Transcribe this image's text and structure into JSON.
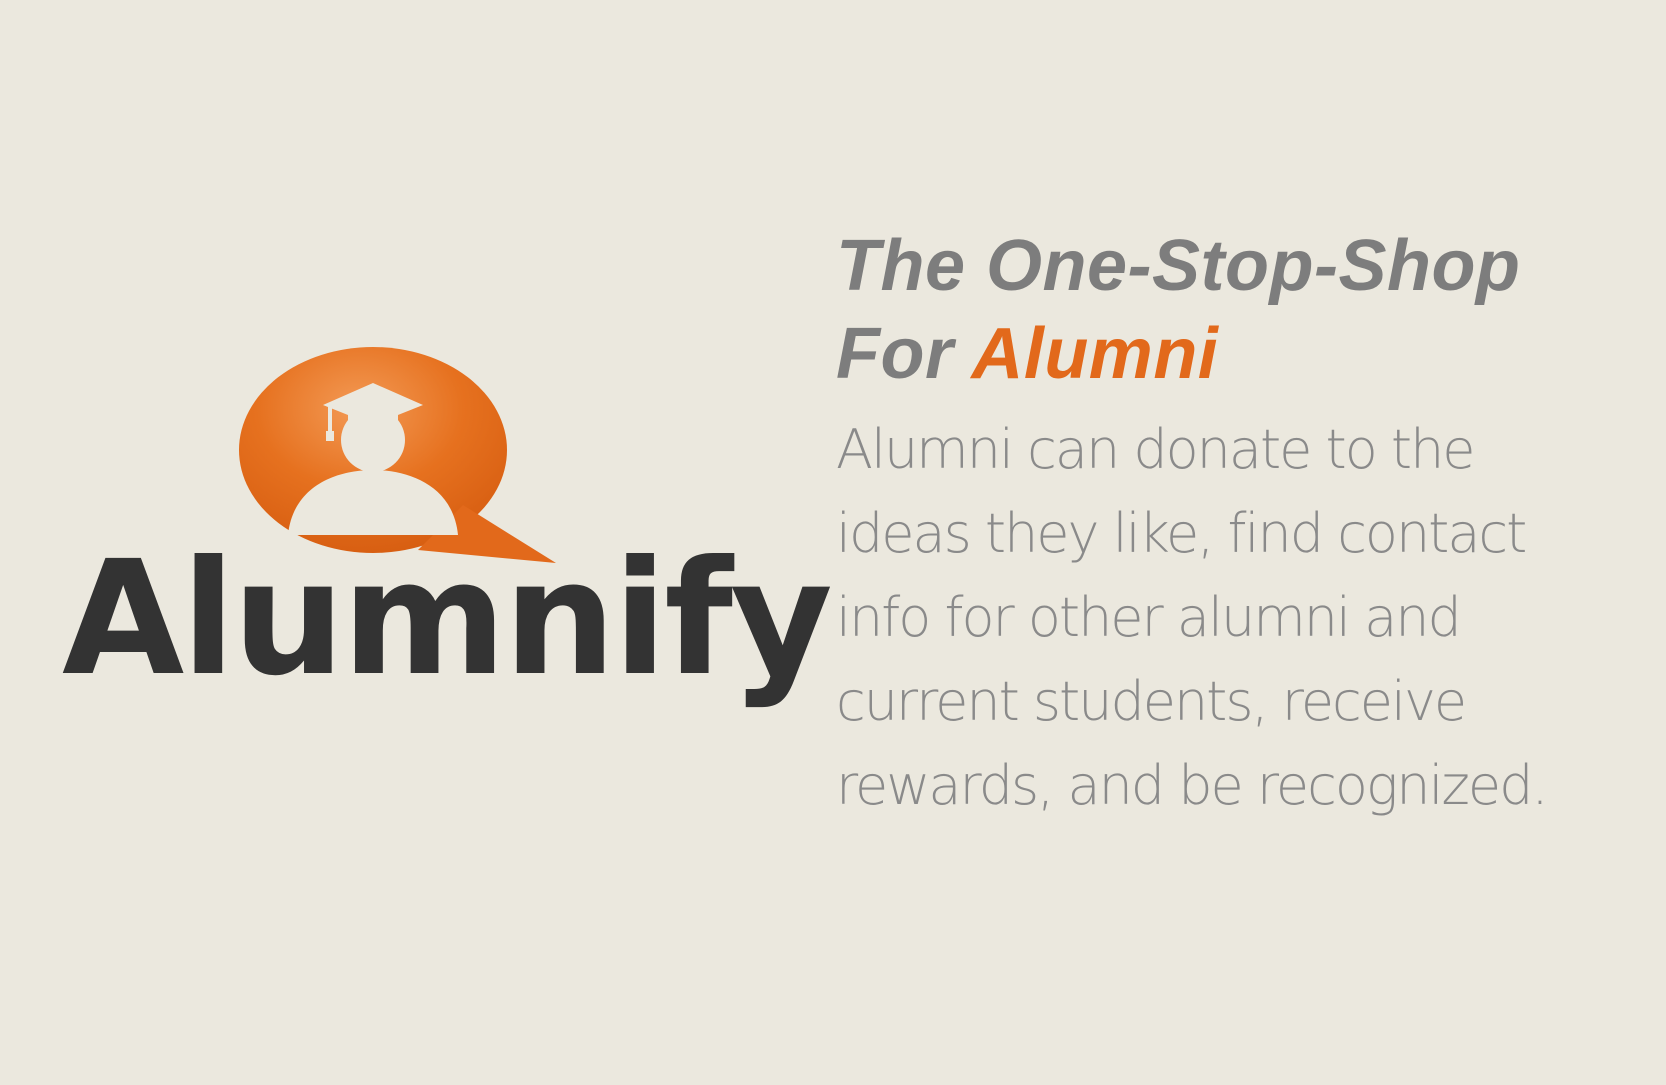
{
  "colors": {
    "background": "#ebe8de",
    "brand_orange": "#e2691b",
    "wordmark": "#333333",
    "headline_gray": "#7d7d7d",
    "body_gray": "#8a8a8a"
  },
  "logo": {
    "icon": "graduate-speech-bubble-icon",
    "wordmark": "Alumnify"
  },
  "headline": {
    "line1": "The One-Stop-Shop",
    "line2_prefix": "For",
    "line2_highlight": "Alumni"
  },
  "body": {
    "lines": [
      "Alumni can donate to the",
      "ideas they like, find contact",
      "info for other alumni and",
      "current students, receive",
      "rewards, and be recognized."
    ]
  }
}
